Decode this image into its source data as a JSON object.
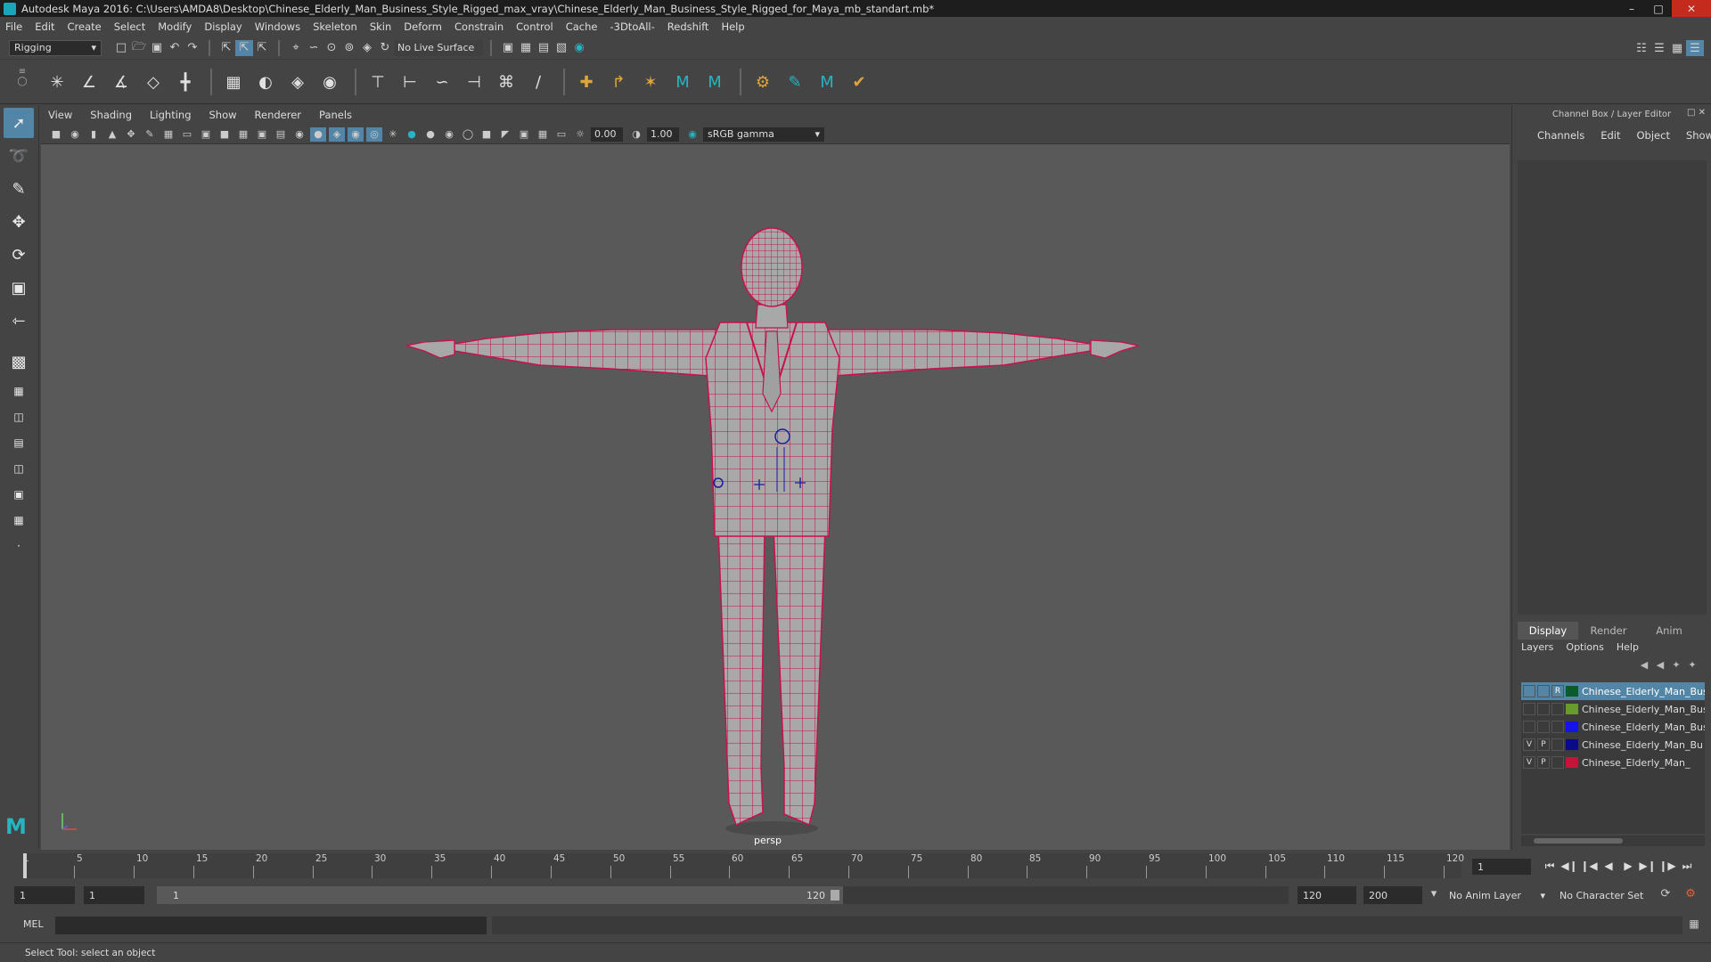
{
  "window": {
    "title": "Autodesk Maya 2016: C:\\Users\\AMDA8\\Desktop\\Chinese_Elderly_Man_Business_Style_Rigged_max_vray\\Chinese_Elderly_Man_Business_Style_Rigged_for_Maya_mb_standart.mb*",
    "minimize": "–",
    "maximize": "□",
    "close": "✕"
  },
  "menubar": [
    "File",
    "Edit",
    "Create",
    "Select",
    "Modify",
    "Display",
    "Windows",
    "Skeleton",
    "Skin",
    "Deform",
    "Constrain",
    "Control",
    "Cache",
    "-3DtoAll-",
    "Redshift",
    "Help"
  ],
  "statusline": {
    "mode": "Rigging",
    "live_surface": "No Live Surface"
  },
  "viewport_panel": {
    "menus": [
      "View",
      "Shading",
      "Lighting",
      "Show",
      "Renderer",
      "Panels"
    ],
    "exposure": "0.00",
    "gamma_value": "1.00",
    "color_space": "sRGB gamma",
    "camera_label": "persp"
  },
  "right_panel": {
    "title": "Channel Box / Layer Editor",
    "channel_menu": [
      "Channels",
      "Edit",
      "Object",
      "Show"
    ],
    "layer_tabs": [
      "Display",
      "Render",
      "Anim"
    ],
    "layer_menu": [
      "Layers",
      "Options",
      "Help"
    ],
    "layers": [
      {
        "v": "",
        "p": "",
        "r": "R",
        "color": "#0b5a2a",
        "name": "Chinese_Elderly_Man_Business",
        "selected": true
      },
      {
        "v": "",
        "p": "",
        "r": "",
        "color": "#6a9a2a",
        "name": "Chinese_Elderly_Man_Business",
        "selected": false
      },
      {
        "v": "",
        "p": "",
        "r": "",
        "color": "#1414e6",
        "name": "Chinese_Elderly_Man_Bus",
        "selected": false
      },
      {
        "v": "V",
        "p": "P",
        "r": "",
        "color": "#0a0a8a",
        "name": "Chinese_Elderly_Man_Bu",
        "selected": false
      },
      {
        "v": "V",
        "p": "P",
        "r": "",
        "color": "#c4143a",
        "name": "Chinese_Elderly_Man_",
        "selected": false
      }
    ]
  },
  "timeline": {
    "ticks": [
      "5",
      "10",
      "15",
      "20",
      "25",
      "30",
      "35",
      "40",
      "45",
      "50",
      "55",
      "60",
      "65",
      "70",
      "75",
      "80",
      "85",
      "90",
      "95",
      "100",
      "105",
      "110",
      "115",
      "120"
    ],
    "first_tick": "1",
    "current_frame": "1",
    "range_start_outer": "1",
    "range_start_inner": "1",
    "range_thumb_start": "1",
    "range_thumb_end": "120",
    "range_end_inner": "120",
    "range_end_outer": "200",
    "anim_layer": "No Anim Layer",
    "character_set": "No Character Set"
  },
  "cmdline": {
    "label": "MEL"
  },
  "helpline": {
    "text": "Select Tool: select an object"
  },
  "colors": {
    "wireframe": "#c8104a",
    "selection_blue": "#5285a6",
    "maya_teal": "#26b4c2"
  }
}
